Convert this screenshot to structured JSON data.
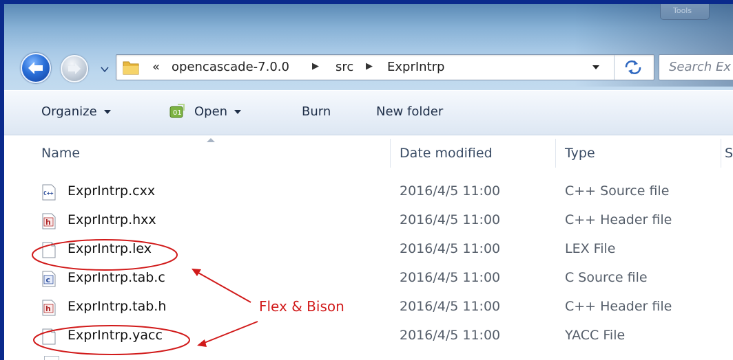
{
  "window": {
    "caption_text": "Tools"
  },
  "navigation": {
    "breadcrumb_overflow": "«",
    "breadcrumbs": [
      "opencascade-7.0.0",
      "src",
      "ExprIntrp"
    ],
    "search_placeholder": "Search Ex"
  },
  "toolbar": {
    "organize_label": "Organize",
    "open_label": "Open",
    "burn_label": "Burn",
    "new_folder_label": "New folder"
  },
  "columns": {
    "name": "Name",
    "date_modified": "Date modified",
    "type": "Type",
    "size_partial": "S"
  },
  "files": [
    {
      "name": "ExprIntrp.cxx",
      "date": "2016/4/5 11:00",
      "type": "C++ Source file",
      "icon": "cpp-source-icon"
    },
    {
      "name": "ExprIntrp.hxx",
      "date": "2016/4/5 11:00",
      "type": "C++ Header file",
      "icon": "header-file-icon"
    },
    {
      "name": "ExprIntrp.lex",
      "date": "2016/4/5 11:00",
      "type": "LEX File",
      "icon": "blank-file-icon"
    },
    {
      "name": "ExprIntrp.tab.c",
      "date": "2016/4/5 11:00",
      "type": "C Source file",
      "icon": "c-source-icon"
    },
    {
      "name": "ExprIntrp.tab.h",
      "date": "2016/4/5 11:00",
      "type": "C++ Header file",
      "icon": "header-file-icon"
    },
    {
      "name": "ExprIntrp.yacc",
      "date": "2016/4/5 11:00",
      "type": "YACC File",
      "icon": "blank-file-icon"
    }
  ],
  "annotation": {
    "label": "Flex & Bison",
    "color": "#d11a1a"
  },
  "colors": {
    "frame_border": "#0a2a8c",
    "toolbar_text": "#1e2e48"
  }
}
